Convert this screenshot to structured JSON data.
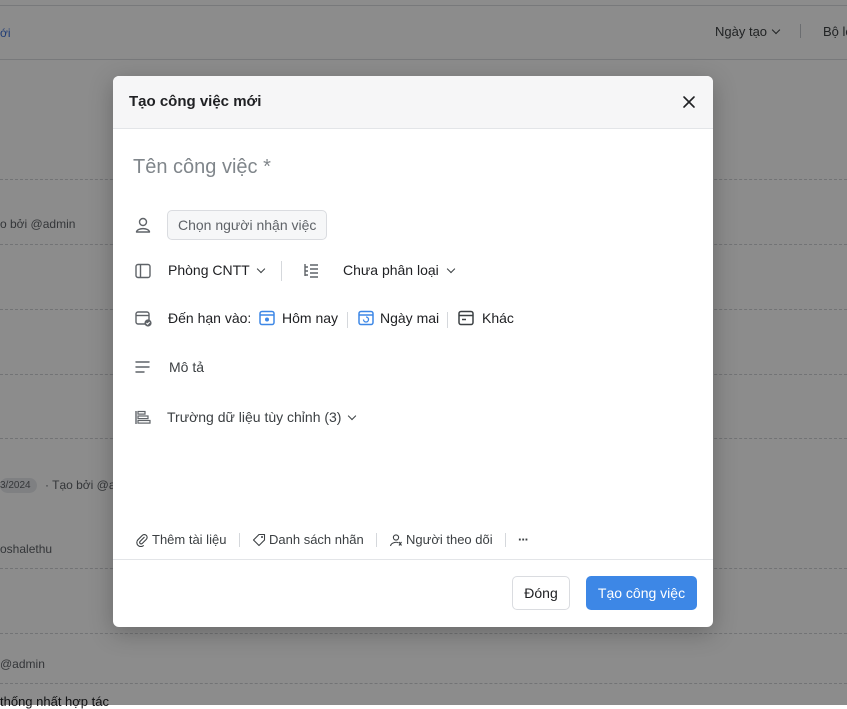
{
  "background": {
    "link_fragment": "ới",
    "sort_label": "Ngày tạo",
    "filter_label": "Bộ lọ",
    "rows": [
      {
        "text": "o bởi @admin"
      },
      {
        "text": "· Tạo bởi @ad"
      },
      {
        "text": "oshalethu"
      },
      {
        "text": "@admin"
      },
      {
        "text": "thống nhất hợp tác"
      }
    ],
    "date_badge": "3/2024"
  },
  "modal": {
    "title": "Tạo công việc mới",
    "task_name_placeholder": "Tên công việc *",
    "assignee_placeholder": "Chọn người nhận việc",
    "department": "Phòng CNTT",
    "category": "Chưa phân loại",
    "due_label": "Đến hạn vào:",
    "due_today": "Hôm nay",
    "due_tomorrow": "Ngày mai",
    "due_other": "Khác",
    "description_label": "Mô tả",
    "custom_fields_label": "Trường dữ liệu tùy chỉnh (3)",
    "toolbar": {
      "attach": "Thêm tài liệu",
      "tags": "Danh sách nhãn",
      "followers": "Người theo dõi",
      "more": "···"
    },
    "buttons": {
      "close": "Đóng",
      "create": "Tạo công việc"
    }
  },
  "colors": {
    "primary": "#3d87e6",
    "icon_blue": "#3d87e6",
    "overlay": "rgba(0,0,0,0.45)"
  }
}
